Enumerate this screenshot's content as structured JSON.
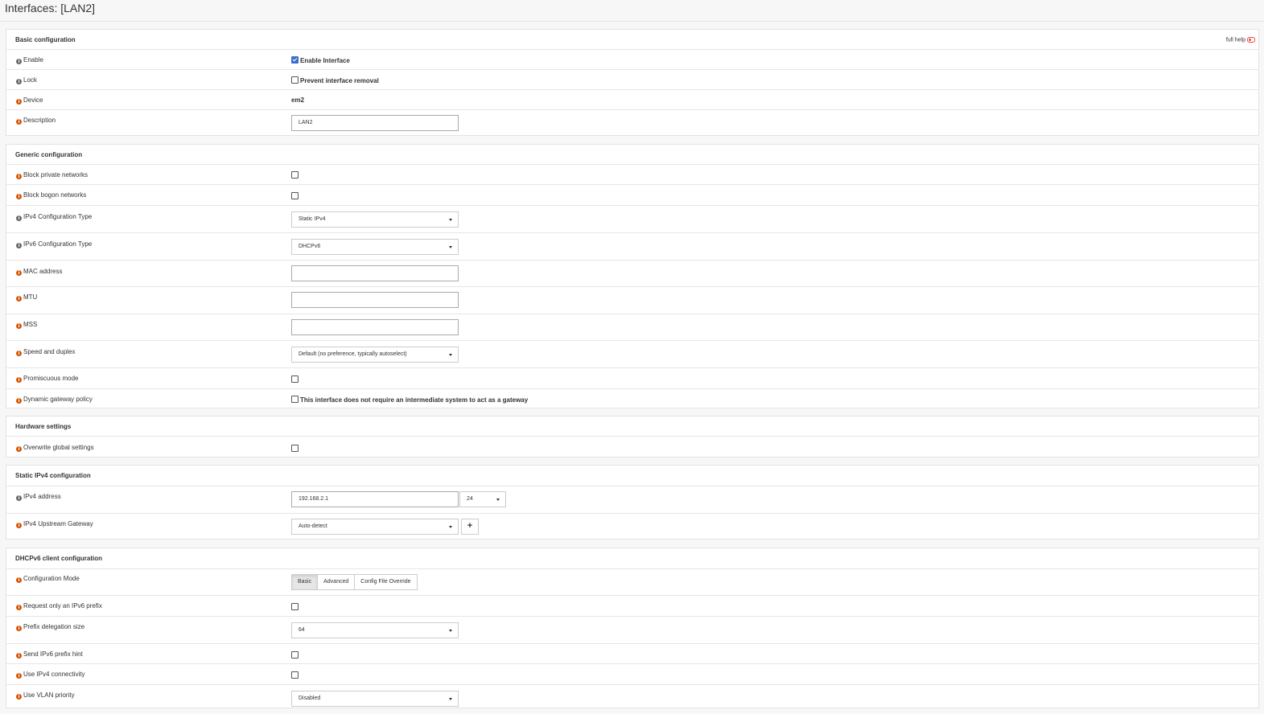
{
  "page": {
    "title": "Interfaces: [LAN2]"
  },
  "basic": {
    "title": "Basic configuration",
    "full_help": "full help",
    "enable": {
      "label": "Enable",
      "checkbox_label": "Enable Interface",
      "checked": true
    },
    "lock": {
      "label": "Lock",
      "checkbox_label": "Prevent interface removal",
      "checked": false
    },
    "device": {
      "label": "Device",
      "value": "em2"
    },
    "description": {
      "label": "Description",
      "value": "LAN2"
    }
  },
  "generic": {
    "title": "Generic configuration",
    "block_private": {
      "label": "Block private networks"
    },
    "block_bogon": {
      "label": "Block bogon networks"
    },
    "ipv4_type": {
      "label": "IPv4 Configuration Type",
      "value": "Static IPv4"
    },
    "ipv6_type": {
      "label": "IPv6 Configuration Type",
      "value": "DHCPv6"
    },
    "mac": {
      "label": "MAC address",
      "value": ""
    },
    "mtu": {
      "label": "MTU",
      "value": ""
    },
    "mss": {
      "label": "MSS",
      "value": ""
    },
    "speed": {
      "label": "Speed and duplex",
      "value": "Default (no preference, typically autoselect)"
    },
    "promisc": {
      "label": "Promiscuous mode"
    },
    "dyn_gw": {
      "label": "Dynamic gateway policy",
      "checkbox_label": "This interface does not require an intermediate system to act as a gateway"
    }
  },
  "hardware": {
    "title": "Hardware settings",
    "overwrite": {
      "label": "Overwrite global settings"
    }
  },
  "static_ipv4": {
    "title": "Static IPv4 configuration",
    "address": {
      "label": "IPv4 address",
      "value": "192.168.2.1",
      "subnet": "24"
    },
    "gateway": {
      "label": "IPv4 Upstream Gateway",
      "value": "Auto-detect",
      "add_label": "+"
    }
  },
  "dhcpv6": {
    "title": "DHCPv6 client configuration",
    "mode": {
      "label": "Configuration Mode",
      "options": [
        "Basic",
        "Advanced",
        "Config File Override"
      ],
      "selected": "Basic"
    },
    "prefix_only": {
      "label": "Request only an IPv6 prefix"
    },
    "prefix_size": {
      "label": "Prefix delegation size",
      "value": "64"
    },
    "prefix_hint": {
      "label": "Send IPv6 prefix hint"
    },
    "use_ipv4": {
      "label": "Use IPv4 connectivity"
    },
    "vlan_prio": {
      "label": "Use VLAN priority",
      "value": "Disabled"
    }
  },
  "colors": {
    "info_orange": "#d35400",
    "info_gray": "#666666",
    "checkbox_blue": "#3b6fc6"
  }
}
